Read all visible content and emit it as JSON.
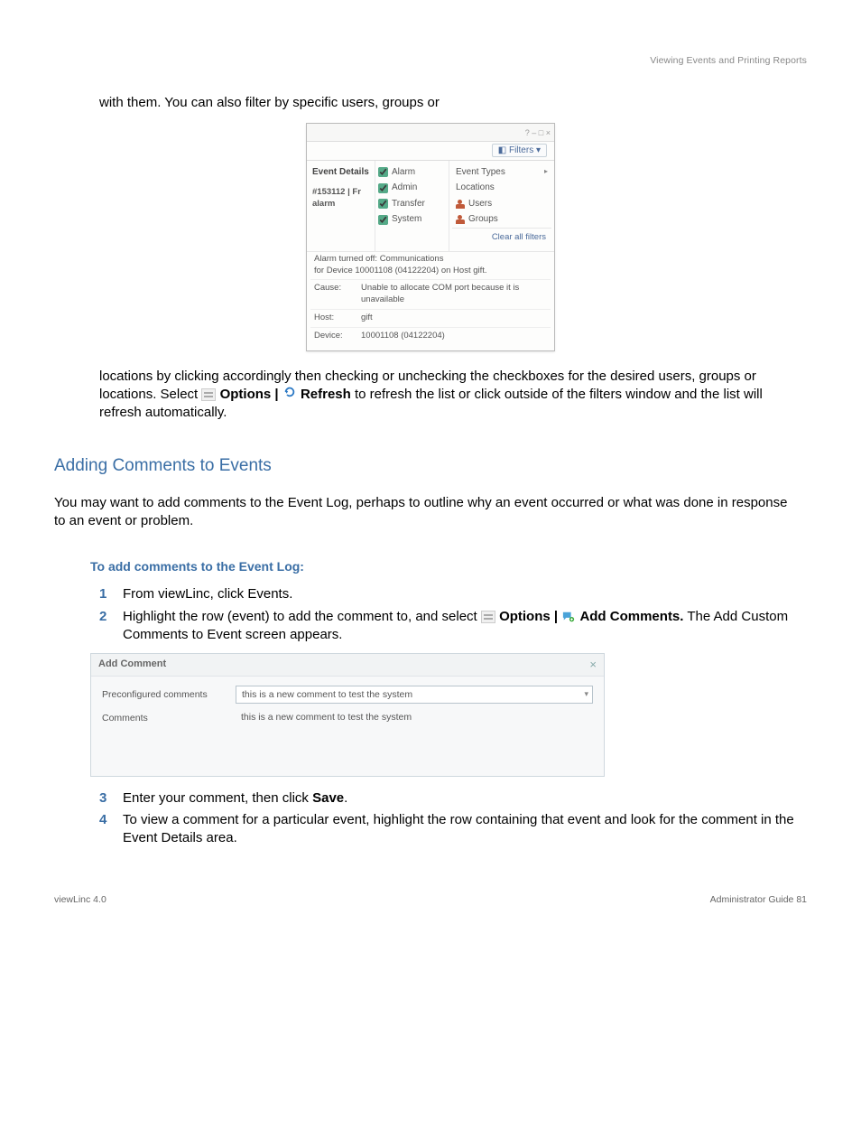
{
  "header": "Viewing Events and Printing Reports",
  "para_top": "with them.  You can also filter by specific users, groups or",
  "filters_win": {
    "titlebar": "?  –  □  ×",
    "filters_button": "Filters ▾",
    "left": {
      "event_details_label": "Event Details",
      "event_id": "#153112 | Fr",
      "alarm_word": "alarm"
    },
    "checkboxes": [
      {
        "label": "Alarm",
        "checked": true
      },
      {
        "label": "Admin",
        "checked": true
      },
      {
        "label": "Transfer",
        "checked": true
      },
      {
        "label": "System",
        "checked": true
      }
    ],
    "right_menu": [
      {
        "label": "Event Types",
        "icon": false,
        "caret": true
      },
      {
        "label": "Locations",
        "icon": false,
        "caret": false
      },
      {
        "label": "Users",
        "icon": true,
        "caret": false
      },
      {
        "label": "Groups",
        "icon": true,
        "caret": false
      }
    ],
    "clear_all": "Clear all filters",
    "desc_line1": "Alarm turned off: Communications",
    "desc_line2": "for Device 10001108 (04122204) on Host gift.",
    "rows": [
      {
        "label": "Cause:",
        "value": "Unable to allocate COM port because it is unavailable"
      },
      {
        "label": "Host:",
        "value": "gift"
      },
      {
        "label": "Device:",
        "value": "10001108 (04122204)"
      }
    ]
  },
  "para_after_filters_1": "locations by clicking accordingly then checking or unchecking the checkboxes for the desired users, groups or locations.  Select",
  "options_label": "Options | ",
  "refresh_label": "Refresh",
  "para_after_filters_2": " to refresh the list or click outside of the filters window and the list will refresh automatically.",
  "section_title": "Adding Comments to Events",
  "section_intro": "You may want to add comments to the Event Log, perhaps to outline why an event occurred or what was done in response to an event or problem.",
  "subtitle": "To add comments to the Event Log:",
  "steps": {
    "s1_text": "From viewLinc, click Events.",
    "s2_a": "Highlight the row (event) to add the comment to, and select",
    "s2_options": "Options | ",
    "s2_addcomments": "Add Comments.",
    "s2_b": " The Add Custom Comments to Event screen appears.",
    "s3_a": "Enter your comment, then click ",
    "s3_save": "Save",
    "s3_b": ".",
    "s4": "To view a comment for a particular event, highlight the row containing that event and look for the comment in the Event Details area."
  },
  "comment_dialog": {
    "title": "Add Comment",
    "close": "×",
    "preconfigured_label": "Preconfigured comments",
    "preconfigured_value": "this is a new comment to test the system",
    "comments_label": "Comments",
    "comments_value": "this is a new comment to test the system"
  },
  "footer_left": "viewLinc 4.0",
  "footer_right": "Administrator Guide      81"
}
